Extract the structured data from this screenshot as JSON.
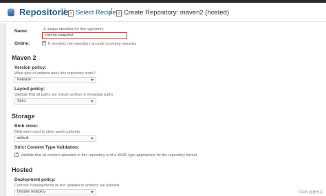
{
  "header": {
    "title": "Repositories",
    "crumb_recipe": "Select Recipe",
    "crumb_create": "Create Repository: maven2 (hosted)",
    "separator": "/"
  },
  "general": {
    "name_label": "Name:",
    "name_help": "A unique identifier for this repository",
    "name_value": "xhiema snapshot",
    "online_label": "Online:",
    "online_checked": true,
    "online_text": "If checked, the repository accepts incoming requests"
  },
  "maven2": {
    "heading": "Maven 2",
    "version_label": "Version policy:",
    "version_help": "What type of artifacts does this repository store?",
    "version_value": "Release",
    "layout_label": "Layout policy:",
    "layout_help": "Validate that all paths are maven artifact or metadata paths",
    "layout_value": "Strict"
  },
  "storage": {
    "heading": "Storage",
    "blob_label": "Blob store:",
    "blob_help": "Blob store used to store asset contents",
    "blob_value": "default",
    "strict_label": "Strict Content Type Validation:",
    "strict_checked": true,
    "strict_text": "Validate that all content uploaded to this repository is of a MIME type appropriate for the repository format"
  },
  "hosted": {
    "heading": "Hosted",
    "deploy_label": "Deployment policy:",
    "deploy_help": "Controls if deployments of and updates to artifacts are allowed",
    "deploy_value": "Disable redeploy"
  },
  "watermark": "CSDN @老大马",
  "colors": {
    "link_blue": "#1f5e93",
    "highlight_red": "#e02a2a",
    "topbar": "#2b2b2b"
  },
  "icons": {
    "header": "database-icon",
    "crumb": "repository-icon",
    "dropdown": "chevron-down-icon"
  }
}
